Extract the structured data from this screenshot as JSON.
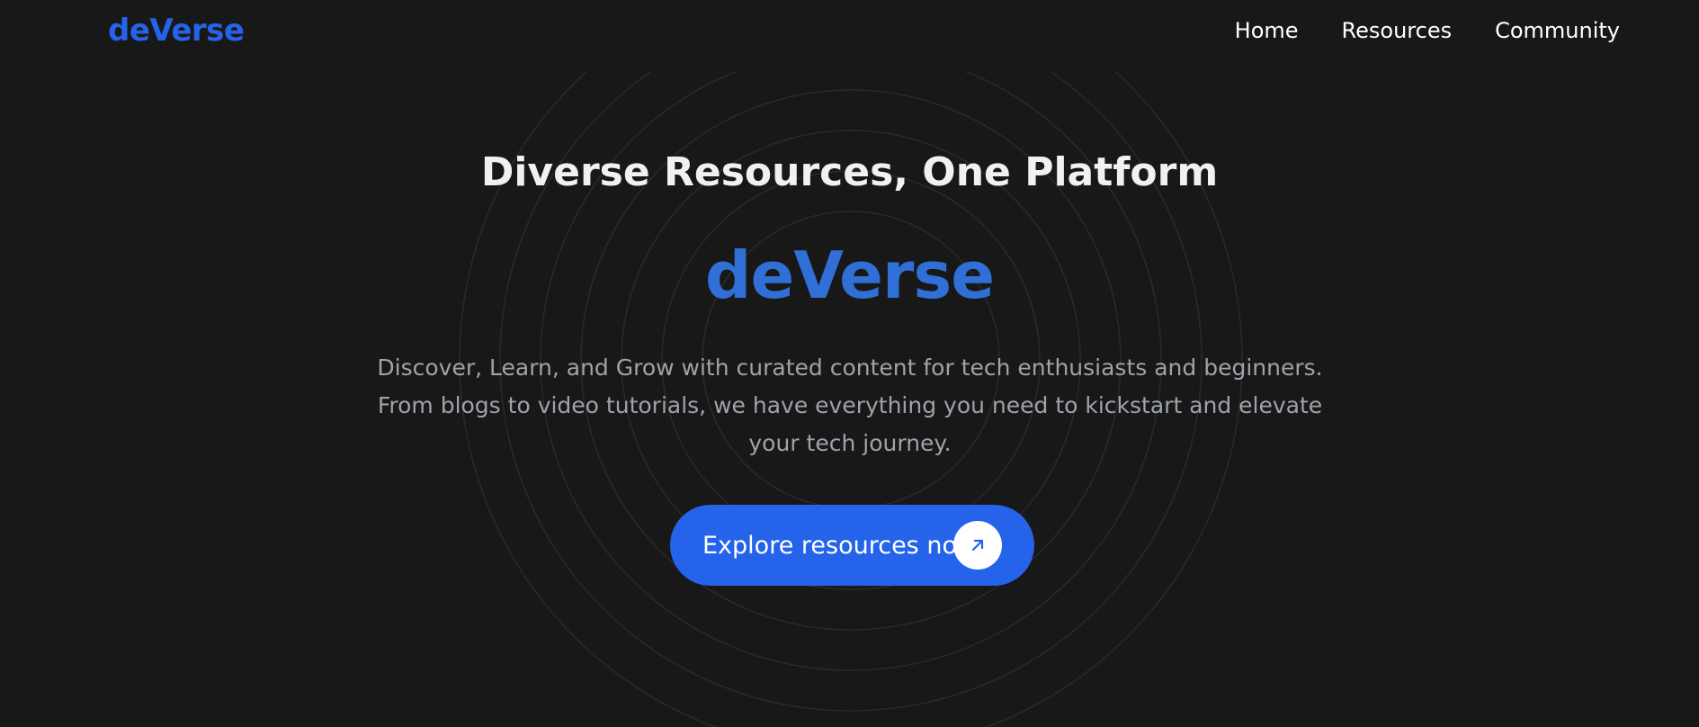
{
  "nav": {
    "brand": "deVerse",
    "links": [
      {
        "label": "Home"
      },
      {
        "label": "Resources"
      },
      {
        "label": "Community"
      }
    ]
  },
  "hero": {
    "title": "Diverse Resources, One Platform",
    "brand": "deVerse",
    "description": "Discover, Learn, and Grow with curated content for tech enthusiasts and beginners. From blogs to video tutorials, we have everything you need to kickstart and elevate your tech journey.",
    "cta_label": "Explore resources now",
    "cta_icon": "arrow-up-right-icon"
  },
  "colors": {
    "background": "#181818",
    "accent": "#2563eb",
    "brand_text": "#2f6fd6",
    "body_text": "#9ea3ab"
  }
}
